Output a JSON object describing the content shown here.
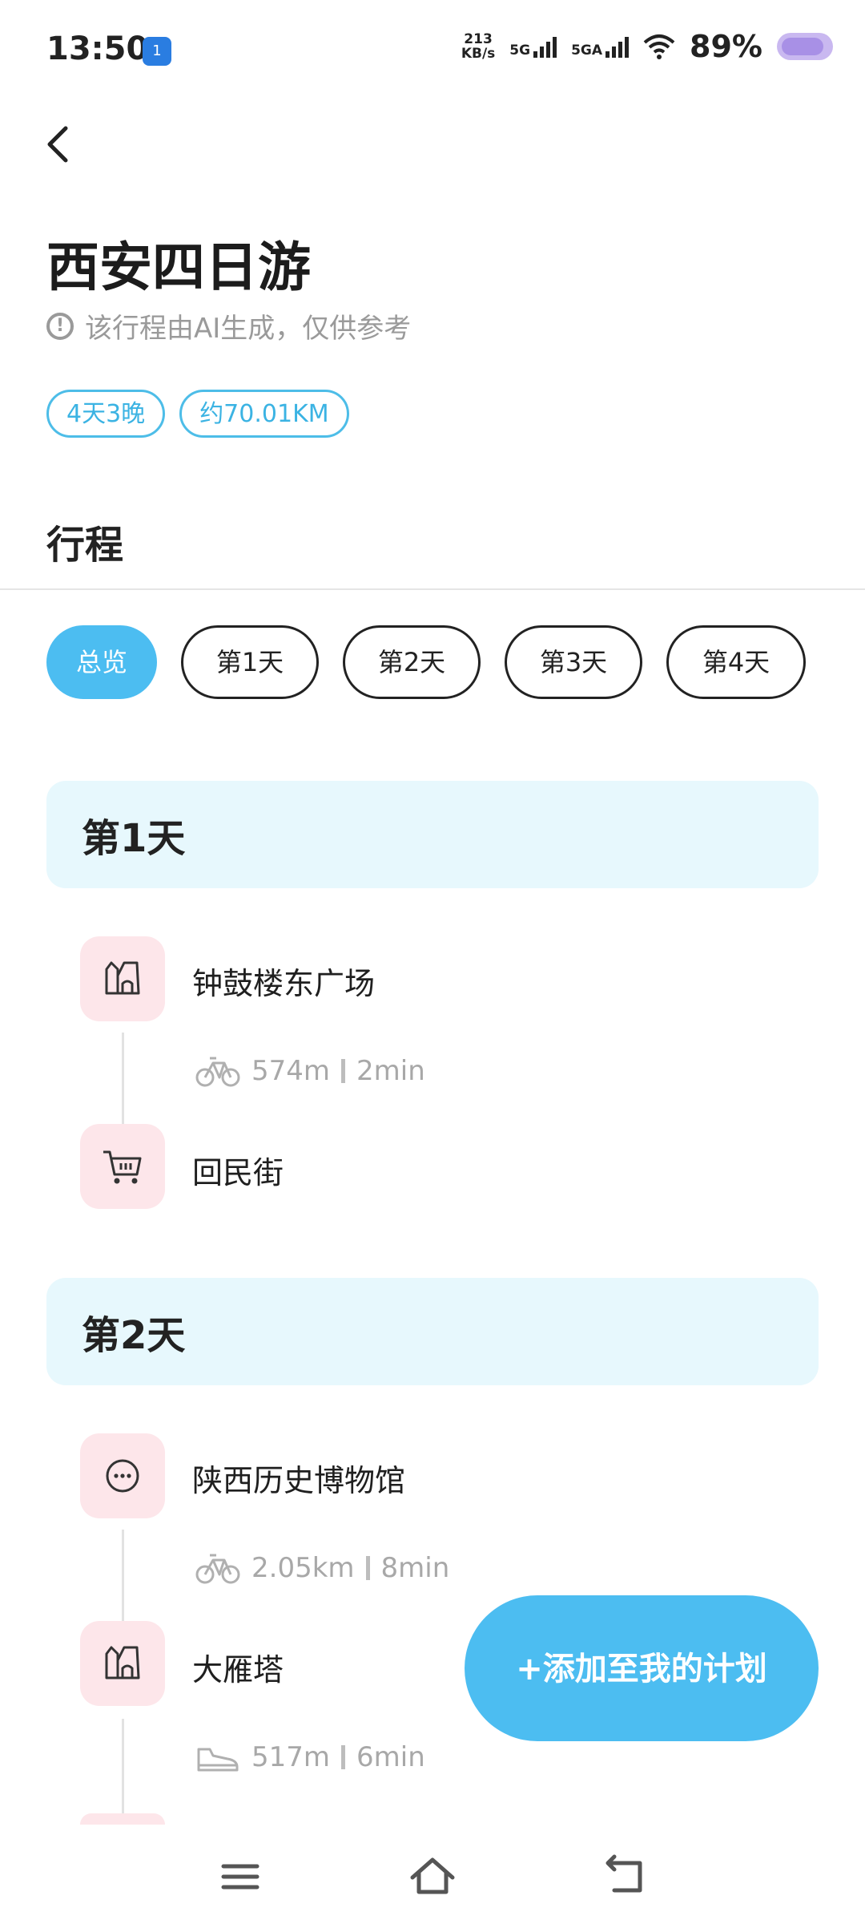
{
  "status_bar": {
    "time": "13:50",
    "app_icon_text": "1",
    "speed_value": "213",
    "speed_unit": "KB/s",
    "net1": "5G",
    "net2": "5GA",
    "battery": "89%"
  },
  "header": {
    "back_icon": "chevron-left-icon",
    "title": "西安四日游",
    "disclaimer": "该行程由AI生成，仅供参考",
    "tags": [
      "4天3晚",
      "约70.01KM"
    ]
  },
  "itinerary": {
    "heading": "行程",
    "tabs": [
      {
        "label": "总览",
        "active": true
      },
      {
        "label": "第1天",
        "active": false
      },
      {
        "label": "第2天",
        "active": false
      },
      {
        "label": "第3天",
        "active": false
      },
      {
        "label": "第4天",
        "active": false
      }
    ],
    "days": [
      {
        "title": "第1天",
        "stops": [
          {
            "name": "钟鼓楼东广场",
            "icon": "landmark-icon"
          },
          {
            "name": "回民街",
            "icon": "shopping-cart-icon"
          }
        ],
        "routes": [
          {
            "mode": "bike-icon",
            "distance": "574m",
            "duration": "2min"
          }
        ]
      },
      {
        "title": "第2天",
        "stops": [
          {
            "name": "陕西历史博物馆",
            "icon": "more-dots-icon"
          },
          {
            "name": "大雁塔",
            "icon": "landmark-icon"
          }
        ],
        "routes": [
          {
            "mode": "bike-icon",
            "distance": "2.05km",
            "duration": "8min"
          },
          {
            "mode": "walk-shoe-icon",
            "distance": "517m",
            "duration": "6min"
          }
        ]
      }
    ]
  },
  "actions": {
    "add_plan": "+添加至我的计划"
  },
  "colors": {
    "accent": "#4cbdf1",
    "tag_border": "#4dbde8",
    "day_card_bg": "#e7f8fd",
    "poi_icon_bg": "#fde6ea"
  }
}
